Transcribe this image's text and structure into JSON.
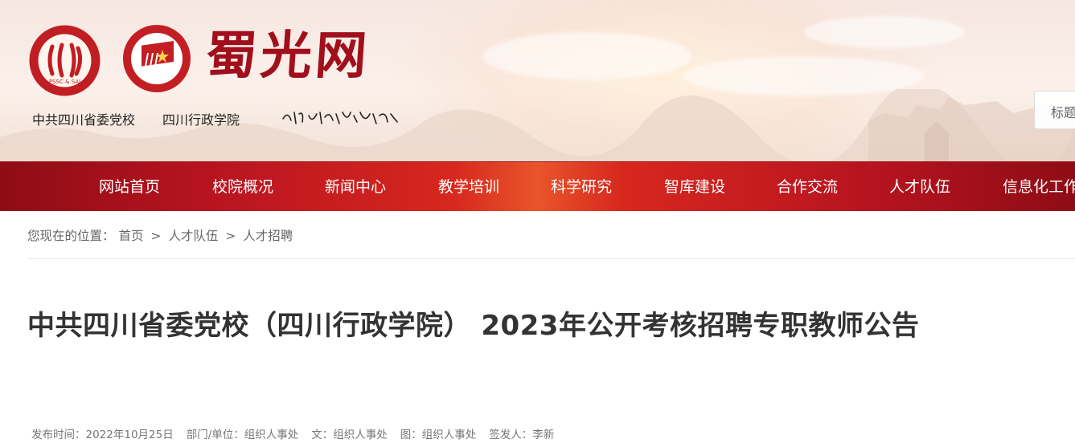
{
  "header": {
    "site_title": "蜀光网",
    "institution_1": "中共四川省委党校",
    "institution_2": "四川行政学院",
    "emblem1_caption": "PSSC & SAI",
    "search_placeholder": "标题"
  },
  "colors": {
    "brand_red": "#a10f1c",
    "nav_red": "#c4171f",
    "nav_highlight": "#e8552a"
  },
  "nav": {
    "items": [
      "网站首页",
      "校院概况",
      "新闻中心",
      "教学培训",
      "科学研究",
      "智库建设",
      "合作交流",
      "人才队伍",
      "信息化工作"
    ]
  },
  "breadcrumb": {
    "prefix": "您现在的位置：",
    "items": [
      "首页",
      "人才队伍",
      "人才招聘"
    ],
    "separator": ">"
  },
  "article": {
    "title": "中共四川省委党校（四川行政学院） 2023年公开考核招聘专职教师公告",
    "meta": {
      "publish_time": "发布时间：2022年10月25日",
      "department": "部门/单位：组织人事处",
      "text_by": "文：组织人事处",
      "image_by": "图：组织人事处",
      "issuer": "签发人：李新"
    }
  }
}
